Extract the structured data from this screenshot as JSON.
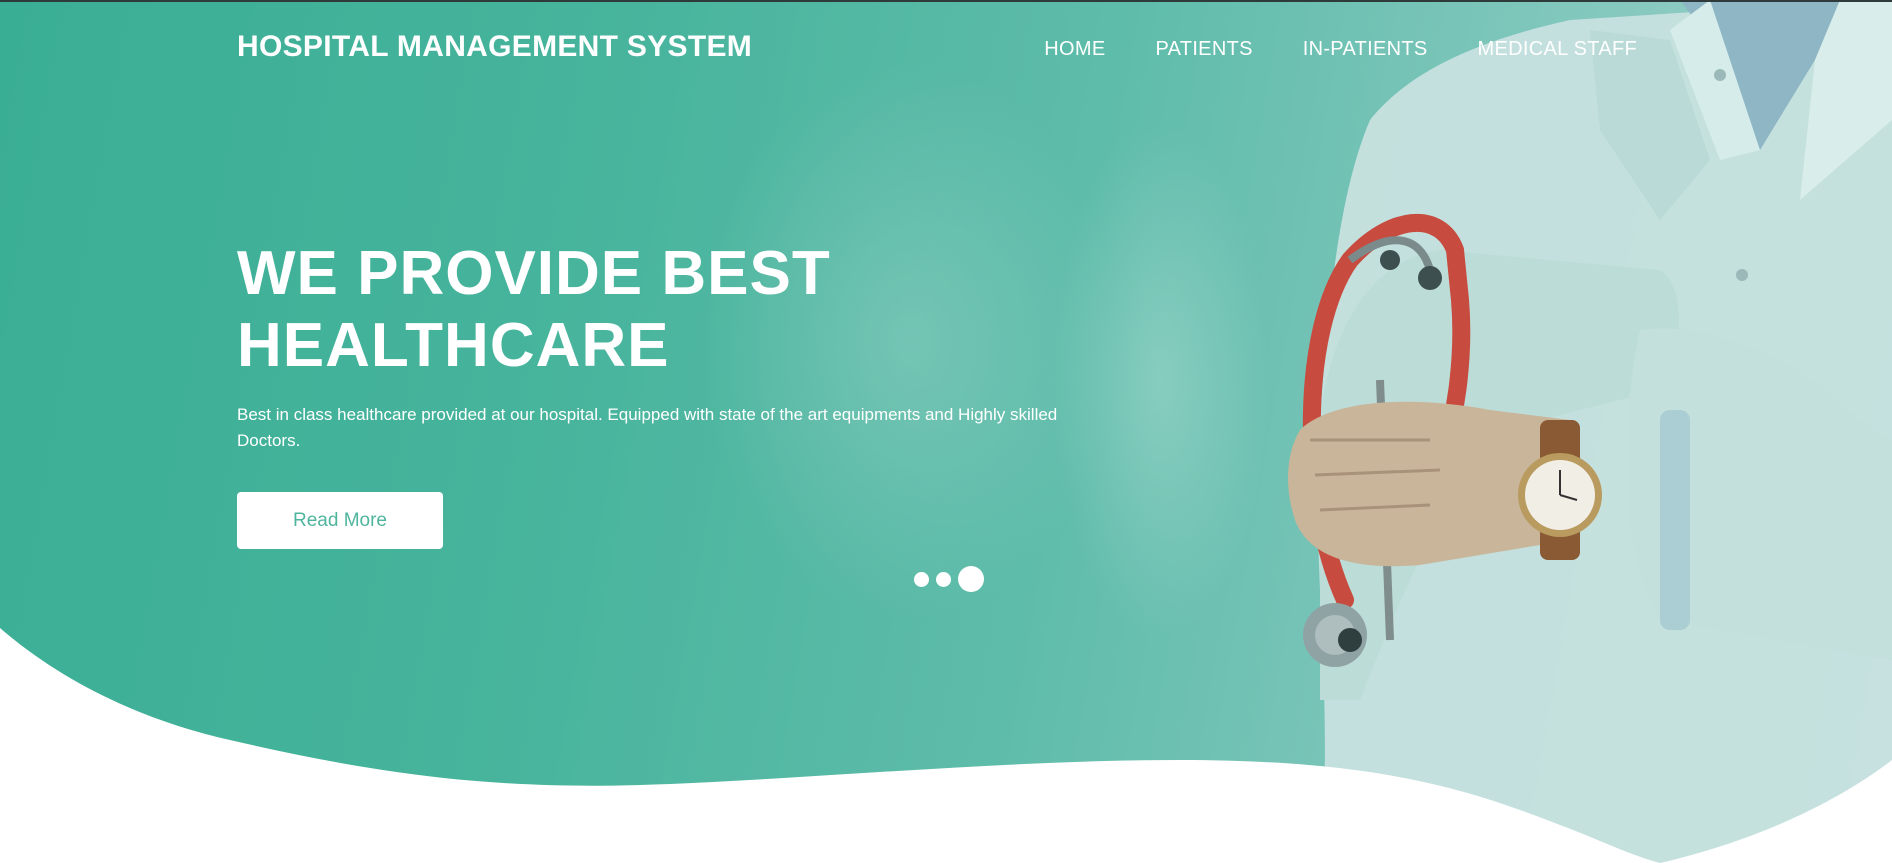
{
  "brand": {
    "title": "HOSPITAL MANAGEMENT SYSTEM"
  },
  "nav": {
    "items": [
      {
        "label": "HOME"
      },
      {
        "label": "PATIENTS"
      },
      {
        "label": "IN-PATIENTS"
      },
      {
        "label": "MEDICAL STAFF"
      }
    ]
  },
  "hero": {
    "headline_line1": "WE PROVIDE BEST",
    "headline_line2": "HEALTHCARE",
    "description": "Best in class healthcare provided at our hospital. Equipped with state of the art equipments and Highly skilled Doctors.",
    "cta_label": "Read More",
    "carousel": {
      "slide_count": 3,
      "active_index": 2
    }
  },
  "colors": {
    "primary": "#47b49c",
    "text_on_primary": "#ffffff",
    "button_text": "#4fb59e"
  },
  "icons": [
    "doctor-illustration",
    "stethoscope",
    "wristwatch"
  ]
}
